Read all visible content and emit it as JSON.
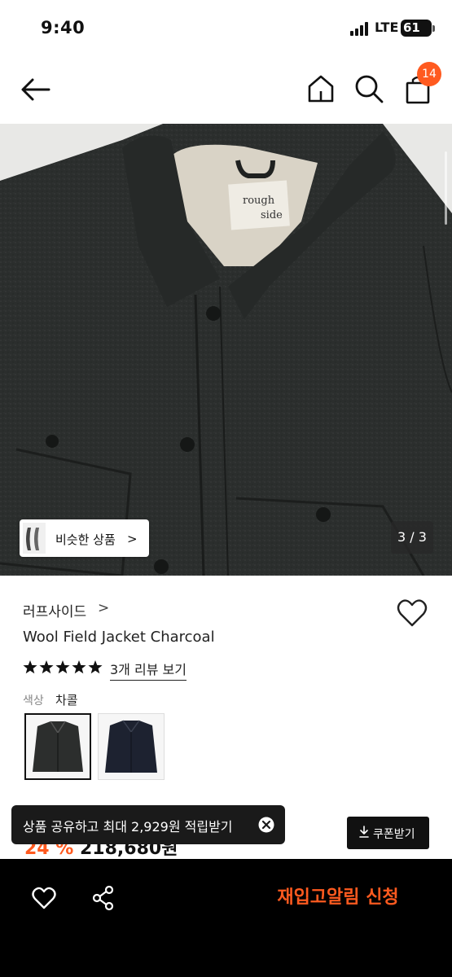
{
  "status_bar": {
    "time": "9:40",
    "network": "LTE",
    "battery": "61"
  },
  "header": {
    "cart_count": "14"
  },
  "gallery": {
    "similar_label": "비슷한 상품",
    "similar_chevron": ">",
    "counter": "3 / 3",
    "label_text_1": "rough",
    "label_text_2": "side"
  },
  "product": {
    "brand": "러프사이드",
    "brand_chevron": ">",
    "name": "Wool Field Jacket Charcoal",
    "rating_stars": 5,
    "review_link": "3개 리뷰 보기",
    "color_label": "색상",
    "color_value": "차콜",
    "swatches": [
      "charcoal",
      "navy"
    ]
  },
  "price": {
    "discount": "24 %",
    "amount": "218,680원"
  },
  "toast": {
    "text": "상품 공유하고 최대 2,929원 적립받기"
  },
  "coupon": {
    "label": "쿠폰받기"
  },
  "bottom_bar": {
    "restock_label": "재입고알림 신청"
  },
  "colors": {
    "accent": "#ff5a1f",
    "dark": "#111111"
  }
}
